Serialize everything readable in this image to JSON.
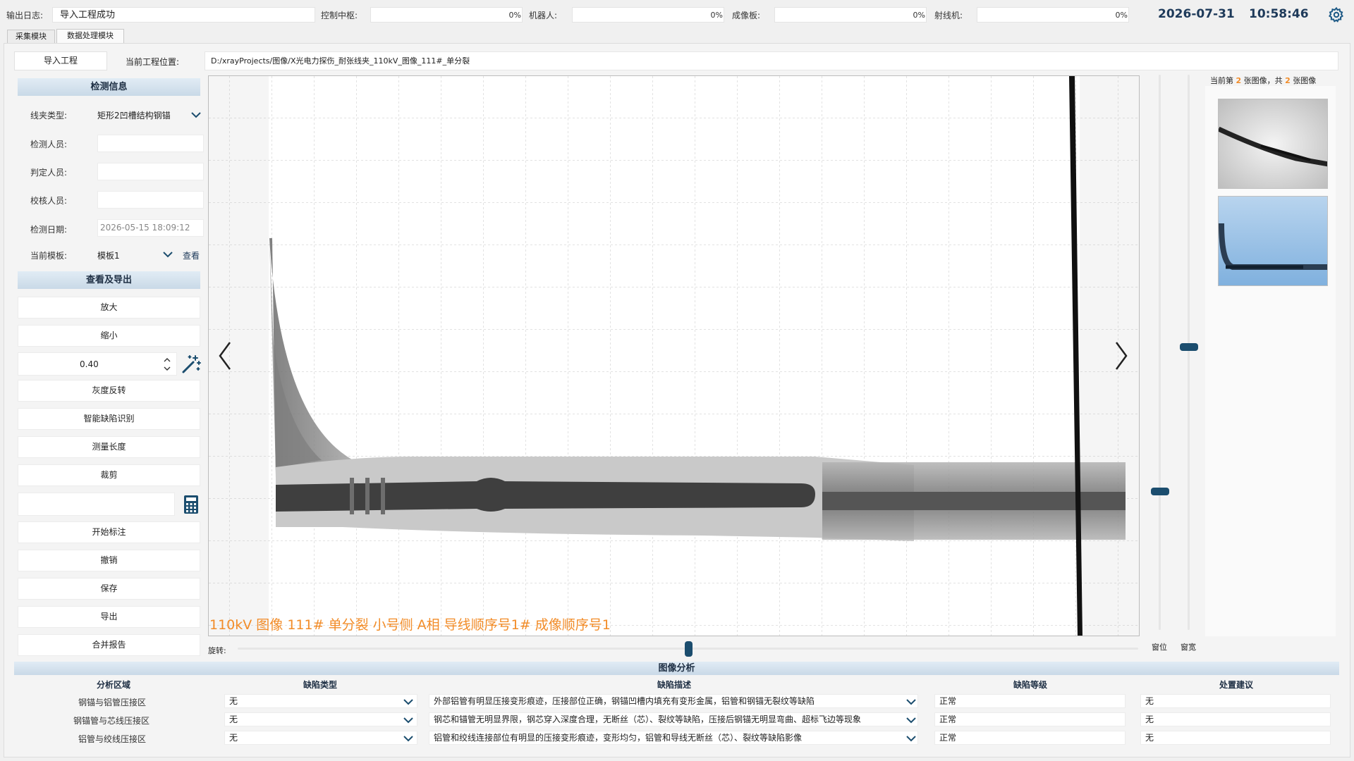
{
  "header": {
    "log_label": "输出日志:",
    "log_value": "导入工程成功",
    "control_label": "控制中枢:",
    "control_pct": "0%",
    "robot_label": "机器人:",
    "robot_pct": "0%",
    "imager_label": "成像板:",
    "imager_pct": "0%",
    "xray_label": "射线机:",
    "xray_pct": "0%",
    "date": "2026-07-31",
    "time": "10:58:46"
  },
  "tabs": [
    "采集模块",
    "数据处理模块"
  ],
  "project": {
    "import_label": "导入工程",
    "location_label": "当前工程位置:",
    "path": "D:/xrayProjects/图像/X光电力探伤_耐张线夹_110kV_图像_111#_单分裂"
  },
  "detect_info": {
    "title": "检测信息",
    "clamp_type_label": "线夹类型:",
    "clamp_type_value": "矩形2凹槽结构钢锚",
    "inspector_label": "检测人员:",
    "judge_label": "判定人员:",
    "reviewer_label": "校核人员:",
    "date_label": "检测日期:",
    "date_value": "2026-05-15 18:09:12",
    "template_label": "当前模板:",
    "template_value": "模板1",
    "view_link": "查看"
  },
  "view_export": {
    "title": "查看及导出",
    "zoom_in": "放大",
    "zoom_out": "缩小",
    "zoom_value": "0.40",
    "invert": "灰度反转",
    "smart_detect": "智能缺陷识别",
    "measure": "测量长度",
    "crop": "裁剪",
    "start_annot": "开始标注",
    "undo": "撤销",
    "save": "保存",
    "export": "导出",
    "merge_report": "合并报告"
  },
  "viewer": {
    "caption": "110kV 图像 111# 单分裂 小号侧 A相 导线顺序号1# 成像顺序号1",
    "rotate_label": "旋转:",
    "rotate_value": 0.5,
    "window_level_label": "窗位",
    "window_width_label": "窗宽",
    "window_level_value": 0.25,
    "window_width_value": 0.51
  },
  "thumbnails": {
    "prefix": "当前第",
    "current": "2",
    "mid": "张图像，共",
    "total": "2",
    "suffix": "张图像"
  },
  "analysis": {
    "title": "图像分析",
    "columns": [
      "分析区域",
      "缺陷类型",
      "缺陷描述",
      "缺陷等级",
      "处置建议"
    ],
    "rows": [
      {
        "region": "钢锚与铝管压接区",
        "type": "无",
        "desc": "外部铝管有明显压接变形痕迹，压接部位正确，钢锚凹槽内填充有变形金属，铝管和钢锚无裂纹等缺陷",
        "level": "正常",
        "advice": "无"
      },
      {
        "region": "钢锚管与芯线压接区",
        "type": "无",
        "desc": "钢芯和锚管无明显界限，钢芯穿入深度合理，无断丝（芯）、裂纹等缺陷，压接后钢锚无明显弯曲、超标飞边等现象",
        "level": "正常",
        "advice": "无"
      },
      {
        "region": "铝管与绞线压接区",
        "type": "无",
        "desc": "铝管和绞线连接部位有明显的压接变形痕迹，变形均匀，铝管和导线无断丝（芯）、裂纹等缺陷影像",
        "level": "正常",
        "advice": "无"
      }
    ]
  },
  "colors": {
    "accent": "#1b4d6e",
    "caption": "#f28c28",
    "header": "#c9d9e7"
  }
}
